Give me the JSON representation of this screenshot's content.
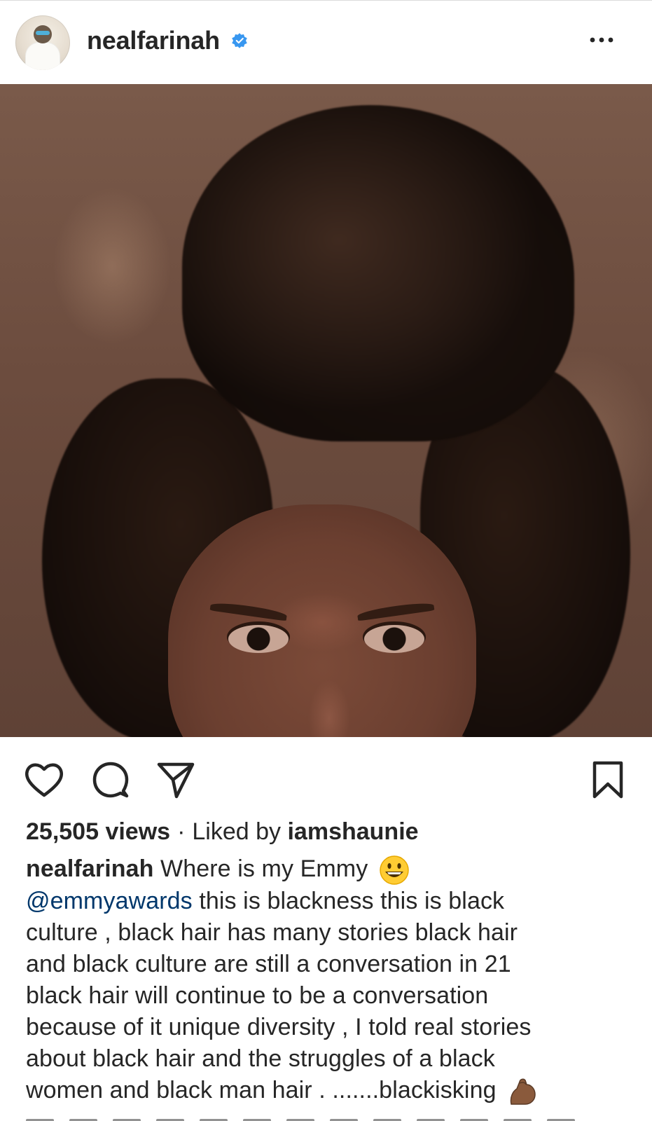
{
  "post": {
    "username": "nealfarinah",
    "verified": true,
    "stats": {
      "views": "25,505 views",
      "separator": "·",
      "liked_by_prefix": "Liked by",
      "liked_by_user": "iamshaunie"
    },
    "caption": {
      "username": "nealfarinah",
      "line1_text": "Where is my Emmy",
      "mention": "@emmyawards",
      "line2_text": "this is blackness this is black",
      "line3": "culture , black hair has many stories black hair",
      "line4": "and black culture are still  a conversation in 21",
      "line5": "black hair will continue to be a conversation",
      "line6": "because of it unique diversity , I told real stories",
      "line7": "about black hair and the struggles of a black",
      "line8": "women and black man hair . .......blackisking"
    }
  },
  "icons": {
    "header_more": "more-horizontal-icon",
    "verified": "verified-badge-icon",
    "like": "heart-icon",
    "comment": "comment-bubble-icon",
    "share": "paper-plane-icon",
    "save": "bookmark-icon",
    "smile_emoji": "grinning-face-emoji",
    "flex_emoji": "flexed-biceps-emoji"
  },
  "colors": {
    "text": "#262626",
    "mention": "#00376b",
    "verified_blue": "#3897f0",
    "divider": "#dbdbdb"
  }
}
